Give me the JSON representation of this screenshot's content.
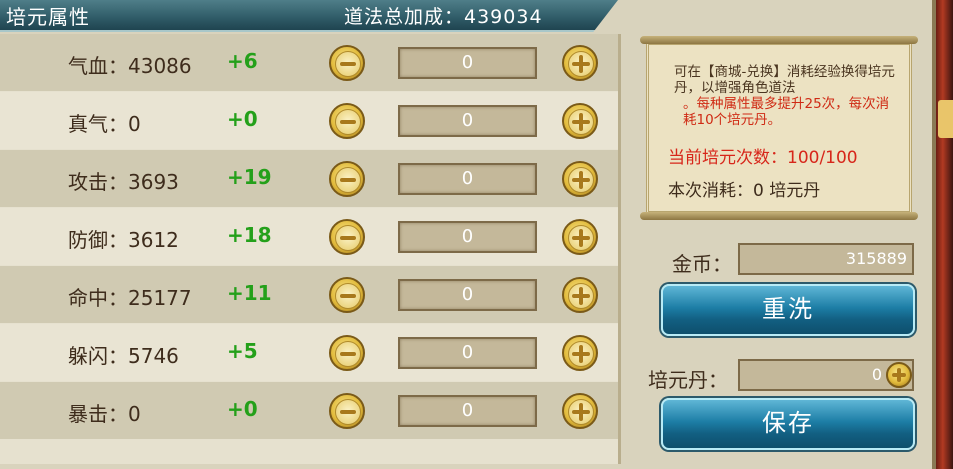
{
  "header": {
    "title": "培元属性",
    "total_power": "道法总加成：439034"
  },
  "attributes": [
    {
      "label": "气血：43086",
      "bonus": "+6",
      "value": "0"
    },
    {
      "label": "真气：0",
      "bonus": "+0",
      "value": "0"
    },
    {
      "label": "攻击：3693",
      "bonus": "+19",
      "value": "0"
    },
    {
      "label": "防御：3612",
      "bonus": "+18",
      "value": "0"
    },
    {
      "label": "命中：25177",
      "bonus": "+11",
      "value": "0"
    },
    {
      "label": "躲闪：5746",
      "bonus": "+5",
      "value": "0"
    },
    {
      "label": "暴击：0",
      "bonus": "+0",
      "value": "0"
    }
  ],
  "info": {
    "desc": "可在【商城-兑换】消耗经验换得培元丹，以增强角色道法",
    "rule": "。每种属性最多提升25次，每次消耗10个培元丹。",
    "current_count": "当前培元次数：100/100",
    "cost": "本次消耗：0 培元丹"
  },
  "gold": {
    "label": "金币：",
    "value": "315889"
  },
  "reset_button": "重洗",
  "pill": {
    "label": "培元丹：",
    "value": "0"
  },
  "save_button": "保存",
  "colors": {
    "bonus_green": "#24a01a",
    "alert_red": "#d7261a",
    "button_blue": "#1d7ea6"
  }
}
